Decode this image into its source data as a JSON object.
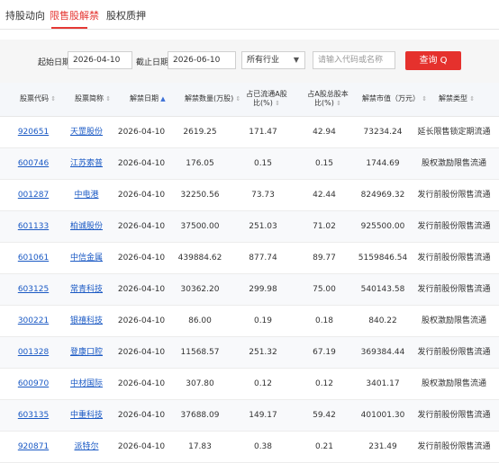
{
  "tabs": [
    {
      "label": "持股动向",
      "active": false
    },
    {
      "label": "限售股解禁",
      "active": true
    },
    {
      "label": "股权质押",
      "active": false
    }
  ],
  "filters": {
    "start_label": "起始日期：",
    "start_value": "2026-04-10",
    "end_label": "截止日期：",
    "end_value": "2026-06-10",
    "industry_value": "所有行业",
    "search_placeholder": "请输入代码或名称",
    "query_label": "查询 Q"
  },
  "table": {
    "columns": [
      {
        "label": "股票代码",
        "sort": "none"
      },
      {
        "label": "股票简称",
        "sort": "none"
      },
      {
        "label": "解禁日期",
        "sort": "asc"
      },
      {
        "label": "解禁数量(万股)",
        "sort": "none"
      },
      {
        "label": "占已流通A股 比(%)",
        "sort": "none"
      },
      {
        "label": "占A股总股本 比(%)",
        "sort": "none"
      },
      {
        "label": "解禁市值（万元）",
        "sort": "none"
      },
      {
        "label": "解禁类型",
        "sort": "none"
      }
    ],
    "rows": [
      {
        "code": "920651",
        "name": "天罡股份",
        "date": "2026-04-10",
        "qty": "2619.25",
        "circ_pct": "171.47",
        "total_pct": "42.94",
        "value": "73234.24",
        "type": "延长限售锁定期流通"
      },
      {
        "code": "600746",
        "name": "江苏索普",
        "date": "2026-04-10",
        "qty": "176.05",
        "circ_pct": "0.15",
        "total_pct": "0.15",
        "value": "1744.69",
        "type": "股权激励限售流通"
      },
      {
        "code": "001287",
        "name": "中电港",
        "date": "2026-04-10",
        "qty": "32250.56",
        "circ_pct": "73.73",
        "total_pct": "42.44",
        "value": "824969.32",
        "type": "发行前股份限售流通"
      },
      {
        "code": "601133",
        "name": "柏诚股份",
        "date": "2026-04-10",
        "qty": "37500.00",
        "circ_pct": "251.03",
        "total_pct": "71.02",
        "value": "925500.00",
        "type": "发行前股份限售流通"
      },
      {
        "code": "601061",
        "name": "中信金属",
        "date": "2026-04-10",
        "qty": "439884.62",
        "circ_pct": "877.74",
        "total_pct": "89.77",
        "value": "5159846.54",
        "type": "发行前股份限售流通"
      },
      {
        "code": "603125",
        "name": "常青科技",
        "date": "2026-04-10",
        "qty": "30362.20",
        "circ_pct": "299.98",
        "total_pct": "75.00",
        "value": "540143.58",
        "type": "发行前股份限售流通"
      },
      {
        "code": "300221",
        "name": "银禧科技",
        "date": "2026-04-10",
        "qty": "86.00",
        "circ_pct": "0.19",
        "total_pct": "0.18",
        "value": "840.22",
        "type": "股权激励限售流通"
      },
      {
        "code": "001328",
        "name": "登康口腔",
        "date": "2026-04-10",
        "qty": "11568.57",
        "circ_pct": "251.32",
        "total_pct": "67.19",
        "value": "369384.44",
        "type": "发行前股份限售流通"
      },
      {
        "code": "600970",
        "name": "中材国际",
        "date": "2026-04-10",
        "qty": "307.80",
        "circ_pct": "0.12",
        "total_pct": "0.12",
        "value": "3401.17",
        "type": "股权激励限售流通"
      },
      {
        "code": "603135",
        "name": "中重科技",
        "date": "2026-04-10",
        "qty": "37688.09",
        "circ_pct": "149.17",
        "total_pct": "59.42",
        "value": "401001.30",
        "type": "发行前股份限售流通"
      },
      {
        "code": "920871",
        "name": "派特尔",
        "date": "2026-04-10",
        "qty": "17.83",
        "circ_pct": "0.38",
        "total_pct": "0.21",
        "value": "231.49",
        "type": "发行前股份限售流通"
      }
    ]
  }
}
